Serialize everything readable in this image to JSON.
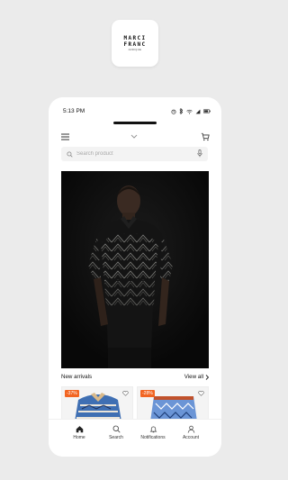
{
  "app_icon": {
    "logo_line1": "MARCI",
    "logo_line2": "FRANC",
    "logo_sub": "AFRIQUE"
  },
  "status": {
    "time": "5:13 PM"
  },
  "search": {
    "placeholder": "Search product"
  },
  "section": {
    "title": "New arrivals",
    "view_all": "View all"
  },
  "products": [
    {
      "badge": "-37%"
    },
    {
      "badge": "-28%"
    }
  ],
  "nav": [
    {
      "label": "Home",
      "icon": "home-icon"
    },
    {
      "label": "Search",
      "icon": "search-icon"
    },
    {
      "label": "Notifications",
      "icon": "bell-icon"
    },
    {
      "label": "Account",
      "icon": "user-icon"
    }
  ],
  "colors": {
    "badge": "#f26522",
    "background": "#ebebeb",
    "hero_bg": "#0b0b0b"
  }
}
